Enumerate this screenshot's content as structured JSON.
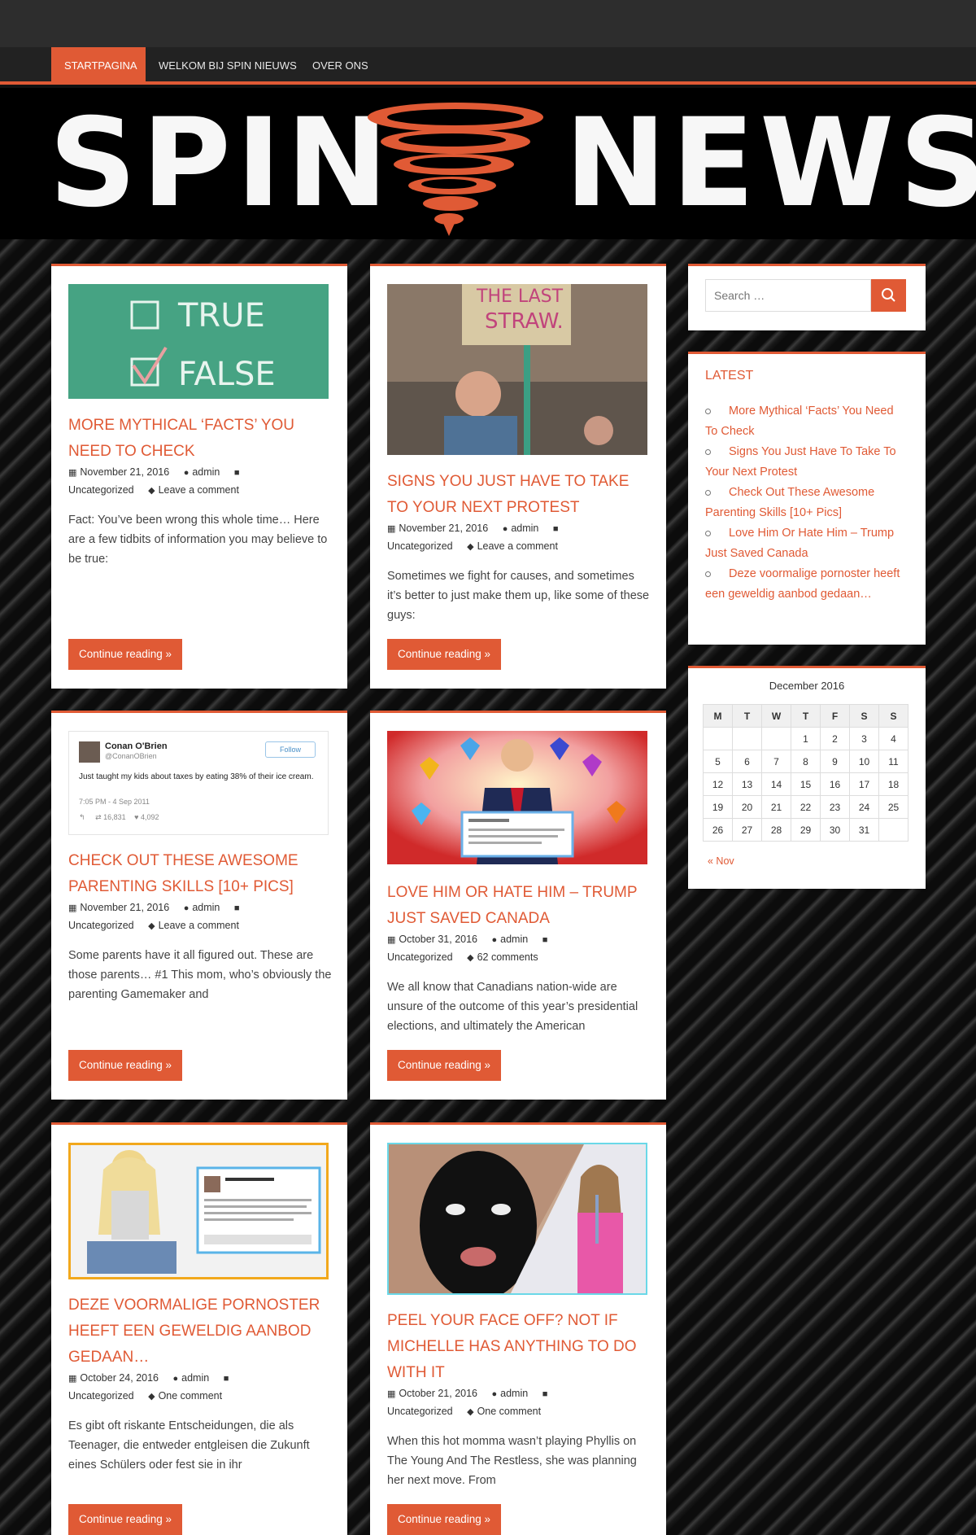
{
  "nav": {
    "items": [
      "STARTPAGINA",
      "WELKOM BIJ SPIN NIEUWS",
      "OVER ONS"
    ],
    "active": "STARTPAGINA"
  },
  "header": {
    "logo_left": "SPIN",
    "logo_right": "NEWS",
    "accent_color": "#e05a35"
  },
  "posts": [
    {
      "title": "MORE MYTHICAL ‘FACTS’ YOU NEED TO CHECK",
      "date": "November 21, 2016",
      "author": "admin",
      "category": "Uncategorized",
      "comments": "Leave a comment",
      "excerpt": "Fact: You’ve been wrong this whole time… Here are a few tidbits of information you may believe to be true:",
      "button": "Continue reading »",
      "image_text": [
        "TRUE",
        "FALSE"
      ]
    },
    {
      "title": "SIGNS YOU JUST HAVE TO TAKE TO YOUR NEXT PROTEST",
      "date": "November 21, 2016",
      "author": "admin",
      "category": "Uncategorized",
      "comments": "Leave a comment",
      "excerpt": "Sometimes we fight for causes, and sometimes it’s better to just make them up, like some of these guys:",
      "button": "Continue reading »",
      "image_text": [
        "THE LAST",
        "STRAW."
      ]
    },
    {
      "title": "CHECK OUT THESE AWESOME PARENTING SKILLS [10+ PICS]",
      "date": "November 21, 2016",
      "author": "admin",
      "category": "Uncategorized",
      "comments": "Leave a comment",
      "excerpt": "Some parents have it all figured out. These are those parents… #1 This mom, who’s obviously the parenting Gamemaker and",
      "button": "Continue reading »",
      "tweet": {
        "name": "Conan O'Brien",
        "handle": "@ConanOBrien",
        "follow": "Follow",
        "text": "Just taught my kids about taxes by eating 38% of their ice cream.",
        "time": "7:05 PM - 4 Sep 2011",
        "retweets": "16,831",
        "likes": "4,092"
      }
    },
    {
      "title": "LOVE HIM OR HATE HIM – TRUMP JUST SAVED CANADA",
      "date": "October 31, 2016",
      "author": "admin",
      "category": "Uncategorized",
      "comments": "62 comments",
      "excerpt": "We all know that Canadians nation-wide are unsure of the outcome of this year’s presidential elections, and ultimately the American",
      "button": "Continue reading »"
    },
    {
      "title": "DEZE VOORMALIGE PORNOSTER HEEFT EEN GEWELDIG AANBOD GEDAAN…",
      "date": "October 24, 2016",
      "author": "admin",
      "category": "Uncategorized",
      "comments": "One comment",
      "excerpt": "Es gibt oft riskante Entscheidungen, die als Teenager, die entweder entgleisen die Zukunft eines Schülers oder fest sie in ihr",
      "button": "Continue reading »"
    },
    {
      "title": "PEEL YOUR FACE OFF? NOT IF MICHELLE HAS ANYTHING TO DO WITH IT",
      "date": "October 21, 2016",
      "author": "admin",
      "category": "Uncategorized",
      "comments": "One comment",
      "excerpt": "When this hot momma wasn’t playing Phyllis on The Young And The Restless, she was planning her next move. From",
      "button": "Continue reading »"
    }
  ],
  "sidebar": {
    "search_placeholder": "Search …",
    "latest_title": "LATEST",
    "latest": [
      "More Mythical ‘Facts’ You Need To Check",
      "Signs You Just Have To Take To Your Next Protest",
      "Check Out These Awesome Parenting Skills [10+ Pics]",
      "Love Him Or Hate Him – Trump Just Saved Canada",
      "Deze voormalige pornoster heeft een geweldig aanbod gedaan…"
    ],
    "calendar": {
      "caption": "December 2016",
      "days": [
        "M",
        "T",
        "W",
        "T",
        "F",
        "S",
        "S"
      ],
      "weeks": [
        [
          "",
          "",
          "",
          "1",
          "2",
          "3",
          "4"
        ],
        [
          "5",
          "6",
          "7",
          "8",
          "9",
          "10",
          "11"
        ],
        [
          "12",
          "13",
          "14",
          "15",
          "16",
          "17",
          "18"
        ],
        [
          "19",
          "20",
          "21",
          "22",
          "23",
          "24",
          "25"
        ],
        [
          "26",
          "27",
          "28",
          "29",
          "30",
          "31",
          ""
        ]
      ],
      "prev": "« Nov"
    }
  }
}
